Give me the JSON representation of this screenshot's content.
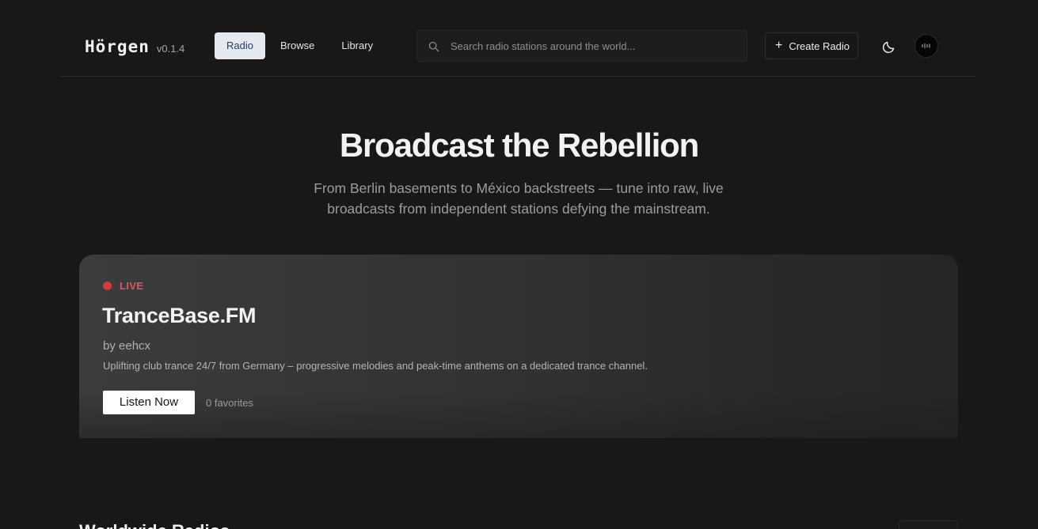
{
  "app": {
    "name": "Hörgen",
    "version": "v0.1.4"
  },
  "nav": {
    "tabs": [
      {
        "label": "Radio",
        "active": true
      },
      {
        "label": "Browse",
        "active": false
      },
      {
        "label": "Library",
        "active": false
      }
    ]
  },
  "search": {
    "placeholder": "Search radio stations around the world...",
    "value": "",
    "icon": "search-icon"
  },
  "header_actions": {
    "create_label": "Create Radio",
    "create_icon": "plus-icon",
    "theme_icon": "moon-icon",
    "avatar_icon": "waveform-icon"
  },
  "hero": {
    "title": "Broadcast the Rebellion",
    "subtitle": "From Berlin basements to México backstreets — tune into raw, live broadcasts from independent stations defying the mainstream."
  },
  "featured": {
    "status": "LIVE",
    "name": "TranceBase.FM",
    "author": "by eehcx",
    "description": "Uplifting club trance 24/7 from Germany – progressive melodies and peak-time anthems on a dedicated trance channel.",
    "listen_label": "Listen Now",
    "favorites": "0 favorites"
  },
  "section": {
    "title": "Worldwide Radios"
  },
  "colors": {
    "background": "#181818",
    "live": "#d23b3b",
    "active_tab_bg": "#e5e8ee",
    "active_tab_text": "#20406e"
  }
}
